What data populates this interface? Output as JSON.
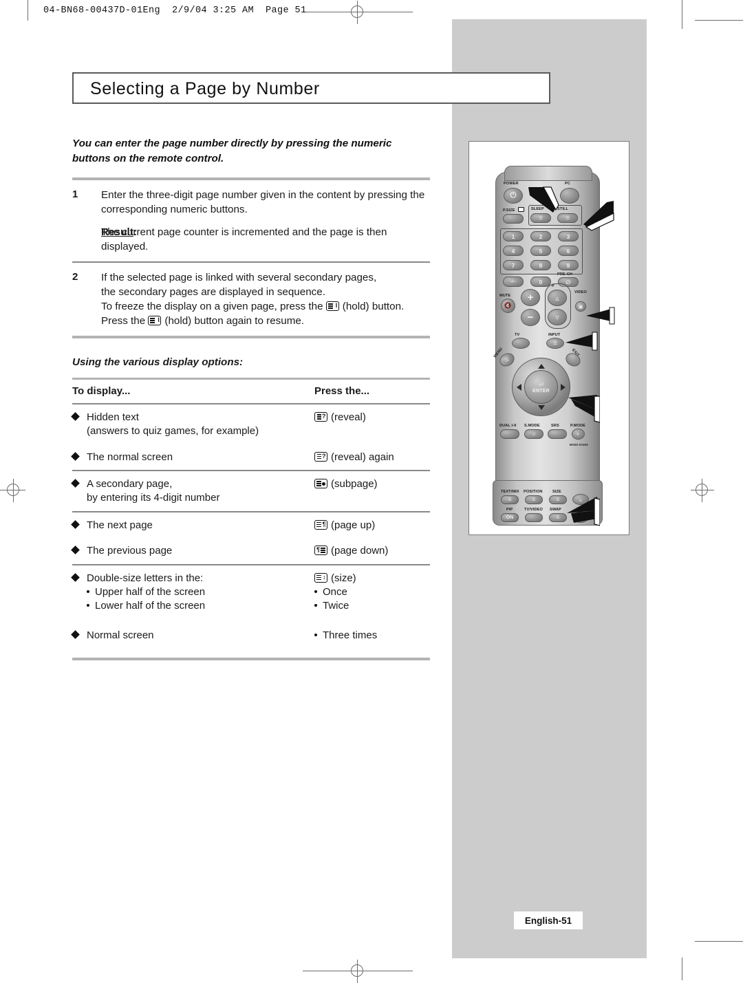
{
  "print_header": "04-BN68-00437D-01Eng  2/9/04 3:25 AM  Page 51",
  "title": "Selecting a Page by Number",
  "intro": "You can enter the page number directly by pressing the numeric buttons on the remote control.",
  "steps": [
    {
      "num": "1",
      "text": "Enter the three-digit page number given in the content by pressing the corresponding numeric buttons.",
      "result_label": "Result",
      "result_colon": ":",
      "result_text": "The current page counter is incremented and the page is then displayed."
    },
    {
      "num": "2",
      "line1": "If the selected page is linked with several secondary pages,",
      "line2": "the secondary pages are displayed in sequence.",
      "line3a": "To freeze the display on a given page, press the",
      "line3b": "(hold) button.",
      "line4a": "Press the",
      "line4b": "(hold) button again to resume."
    }
  ],
  "subhead": "Using the various display options:",
  "table": {
    "headers": [
      "To display...",
      "Press the..."
    ],
    "rows": [
      {
        "bullet": "diamond",
        "left_line1": "Hidden text",
        "left_line2": "(answers to quiz games, for example)",
        "right_icon": "reveal-key-icon",
        "right_text": "(reveal)"
      },
      {
        "bullet": "diamond",
        "left_line1": "The normal screen",
        "right_icon": "reveal-key-icon",
        "right_text": "(reveal) again"
      },
      {
        "bullet": "diamond",
        "left_line1": "A secondary page,",
        "left_line2": "by entering its 4-digit number",
        "right_icon": "subpage-key-icon",
        "right_text": "(subpage)"
      },
      {
        "bullet": "diamond",
        "left_line1": "The next page",
        "right_icon": "page-up-key-icon",
        "right_text": "(page up)"
      },
      {
        "bullet": "diamond",
        "left_line1": "The previous page",
        "right_icon": "page-down-key-icon",
        "right_text": "(page down)"
      },
      {
        "bullet": "diamond",
        "left_line1": "Double-size letters in the:",
        "sub_left": [
          "Upper half of the screen",
          "Lower half of the screen"
        ],
        "right_icon": "size-key-icon",
        "right_text": "(size)",
        "sub_right": [
          "Once",
          "Twice"
        ]
      },
      {
        "bullet": "diamond",
        "left_line1": "Normal screen",
        "sub_right": [
          "Three times"
        ]
      }
    ]
  },
  "page_tab": "English-51",
  "remote": {
    "model_number": "BN59-00369",
    "labels": {
      "power": "POWER",
      "pc": "PC",
      "psize": "P.SIZE",
      "sleep": "SLEEP",
      "still": "STILL",
      "prech": "PRE-CH",
      "mute": "MUTE",
      "video": "VIDEO",
      "p_channel": "P",
      "tv": "TV",
      "input": "INPUT",
      "menu": "MENU",
      "exit": "EXIT",
      "enter": "ENTER",
      "dual": "DUAL I-II",
      "smode": "S.MODE",
      "srs": "SRS",
      "pmode": "P.MODE",
      "textmix": "TEXT/MIX",
      "position": "POSITION",
      "size": "SIZE",
      "pip": "PIP",
      "tvvideo": "TV/VIDEO",
      "swap": "SWAP",
      "pip_on": "ON",
      "minus_bar": "-/--"
    },
    "numeric_keys": [
      "1",
      "2",
      "3",
      "4",
      "5",
      "6",
      "7",
      "8",
      "9",
      "0"
    ]
  },
  "colors": {
    "panel_gray": "#cccccc",
    "rule_gray": "#b3b3b3",
    "text": "#1a1a1a",
    "border": "#5a5a5a"
  }
}
